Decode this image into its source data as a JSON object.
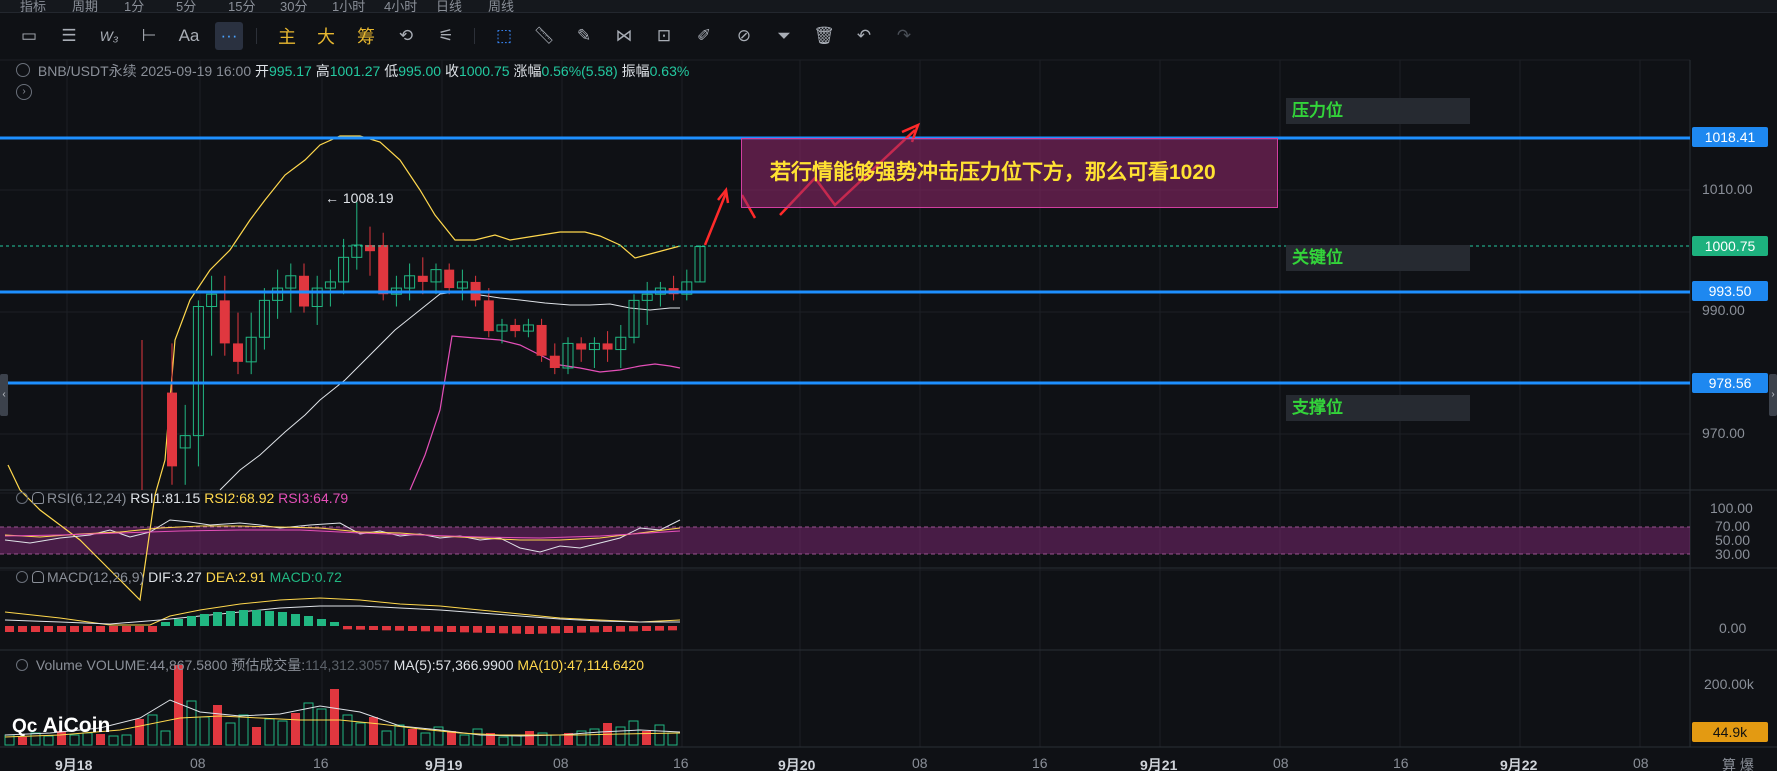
{
  "topbar_cut": [
    "指标",
    "周期",
    "1分",
    "5分",
    "15分",
    "30分",
    "1小时",
    "4小时",
    "日线",
    "周线"
  ],
  "toolbar": {
    "aa_label": "Aa",
    "more_label": "···",
    "main_label": "主",
    "big_label": "大",
    "chip_label": "筹"
  },
  "legend": {
    "symbol": "BNB/USDT永续",
    "datetime": "2025-09-19 16:00",
    "open_label": "开",
    "open": "995.17",
    "high_label": "高",
    "high": "1001.27",
    "low_label": "低",
    "low": "995.00",
    "close_label": "收",
    "close": "1000.75",
    "change_label": "涨幅",
    "change": "0.56%(5.58)",
    "amp_label": "振幅",
    "amp": "0.63%"
  },
  "levels": {
    "resistance": {
      "label": "压力位",
      "price": "1018.41"
    },
    "key": {
      "label": "关键位",
      "price": "993.50"
    },
    "support": {
      "label": "支撑位",
      "price": "978.56"
    },
    "current_price": "1000.75",
    "high_marker": "← 1008.19"
  },
  "annotation": "若行情能够强势冲击压力位下方，那么可看1020",
  "price_axis": [
    "1010.00",
    "990.00",
    "970.00"
  ],
  "rsi": {
    "name": "RSI(6,12,24)",
    "rsi1": "RSI1:81.15",
    "rsi2": "RSI2:68.92",
    "rsi3": "RSI3:64.79",
    "ticks": [
      "100.00",
      "70.00",
      "50.00",
      "30.00"
    ]
  },
  "macd": {
    "name": "MACD(12,26,9)",
    "dif": "DIF:3.27",
    "dea": "DEA:2.91",
    "macd": "MACD:0.72",
    "tick": "0.00"
  },
  "volume": {
    "name": "Volume",
    "volume": "VOLUME:44,867.5800",
    "est_label": "预估成交量:",
    "est": "114,312.3057",
    "ma5": "MA(5):57,366.9900",
    "ma10": "MA(10):47,114.6420",
    "tick": "200.00k",
    "current": "44.9k"
  },
  "x_axis": [
    {
      "label": "9月18",
      "bold": true
    },
    {
      "label": "08",
      "bold": false
    },
    {
      "label": "16",
      "bold": false
    },
    {
      "label": "9月19",
      "bold": true
    },
    {
      "label": "08",
      "bold": false
    },
    {
      "label": "16",
      "bold": false
    },
    {
      "label": "9月20",
      "bold": true
    },
    {
      "label": "08",
      "bold": false
    },
    {
      "label": "16",
      "bold": false
    },
    {
      "label": "9月21",
      "bold": true
    },
    {
      "label": "08",
      "bold": false
    },
    {
      "label": "16",
      "bold": false
    },
    {
      "label": "9月22",
      "bold": true
    },
    {
      "label": "08",
      "bold": false
    }
  ],
  "x_axis_tail": "算 爆",
  "logo": "AiCoin",
  "colors": {
    "up": "#21b782",
    "down": "#e0373f",
    "level_line": "#1e90ff",
    "ma_yellow": "#ffd84d",
    "ma_white": "#dfe3e8",
    "ma_magenta": "#e44fb8"
  },
  "candles": [
    {
      "o": 977,
      "h": 985,
      "l": 962,
      "c": 965
    },
    {
      "o": 968,
      "h": 975,
      "l": 962,
      "c": 970
    },
    {
      "o": 970,
      "h": 992,
      "l": 965,
      "c": 991
    },
    {
      "o": 991,
      "h": 996,
      "l": 983,
      "c": 993
    },
    {
      "o": 992,
      "h": 996,
      "l": 983,
      "c": 985
    },
    {
      "o": 985,
      "h": 990,
      "l": 980,
      "c": 982
    },
    {
      "o": 982,
      "h": 990,
      "l": 980,
      "c": 986
    },
    {
      "o": 986,
      "h": 994,
      "l": 984,
      "c": 992
    },
    {
      "o": 992,
      "h": 997,
      "l": 989,
      "c": 994
    },
    {
      "o": 994,
      "h": 998,
      "l": 990,
      "c": 996
    },
    {
      "o": 996,
      "h": 998,
      "l": 990,
      "c": 991
    },
    {
      "o": 991,
      "h": 996,
      "l": 988,
      "c": 994
    },
    {
      "o": 994,
      "h": 997,
      "l": 991,
      "c": 995
    },
    {
      "o": 995,
      "h": 1002,
      "l": 993,
      "c": 999
    },
    {
      "o": 999,
      "h": 1008,
      "l": 997,
      "c": 1001
    },
    {
      "o": 1001,
      "h": 1004,
      "l": 996,
      "c": 1000
    },
    {
      "o": 1001,
      "h": 1003,
      "l": 992,
      "c": 993
    },
    {
      "o": 993,
      "h": 996,
      "l": 991,
      "c": 994
    },
    {
      "o": 994,
      "h": 998,
      "l": 992,
      "c": 996
    },
    {
      "o": 996,
      "h": 999,
      "l": 993,
      "c": 995
    },
    {
      "o": 995,
      "h": 998,
      "l": 993,
      "c": 997
    },
    {
      "o": 997,
      "h": 998,
      "l": 993,
      "c": 994
    },
    {
      "o": 994,
      "h": 997,
      "l": 992,
      "c": 995
    },
    {
      "o": 995,
      "h": 996,
      "l": 991,
      "c": 992
    },
    {
      "o": 992,
      "h": 994,
      "l": 986,
      "c": 987
    },
    {
      "o": 987,
      "h": 989,
      "l": 985,
      "c": 988
    },
    {
      "o": 988,
      "h": 989,
      "l": 986,
      "c": 987
    },
    {
      "o": 987,
      "h": 989,
      "l": 986,
      "c": 988
    },
    {
      "o": 988,
      "h": 989,
      "l": 982,
      "c": 983
    },
    {
      "o": 983,
      "h": 985,
      "l": 980,
      "c": 981
    },
    {
      "o": 981,
      "h": 986,
      "l": 980,
      "c": 985
    },
    {
      "o": 985,
      "h": 986,
      "l": 982,
      "c": 984
    },
    {
      "o": 984,
      "h": 986,
      "l": 981,
      "c": 985
    },
    {
      "o": 985,
      "h": 987,
      "l": 982,
      "c": 984
    },
    {
      "o": 984,
      "h": 988,
      "l": 981,
      "c": 986
    },
    {
      "o": 986,
      "h": 993,
      "l": 985,
      "c": 992
    },
    {
      "o": 992,
      "h": 995,
      "l": 988,
      "c": 993
    },
    {
      "o": 993,
      "h": 995,
      "l": 991,
      "c": 994
    },
    {
      "o": 994,
      "h": 996,
      "l": 992,
      "c": 993
    },
    {
      "o": 993,
      "h": 997,
      "l": 992,
      "c": 995
    },
    {
      "o": 995,
      "h": 1001,
      "l": 995,
      "c": 1000.75
    }
  ]
}
